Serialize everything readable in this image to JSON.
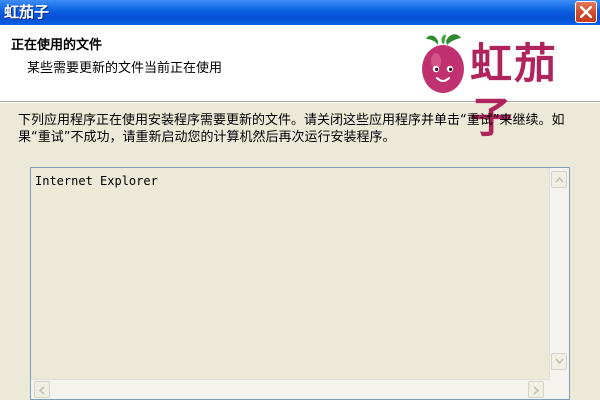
{
  "window": {
    "title": "虹茄子",
    "close_icon": "close-icon"
  },
  "header": {
    "heading": "正在使用的文件",
    "subheading": "某些需要更新的文件当前正在使用",
    "logo_text": "虹茄子"
  },
  "body": {
    "instructions": "下列应用程序正在使用安装程序需要更新的文件。请关闭这些应用程序并单击“重试”来继续。如果“重试”不成功，请重新启动您的计算机然后再次运行安装程序。"
  },
  "file_list": {
    "items": [
      "Internet Explorer"
    ]
  },
  "colors": {
    "titlebar": "#0a5fe0",
    "dialog_bg": "#ece9d8",
    "logo_accent": "#b0245e"
  }
}
